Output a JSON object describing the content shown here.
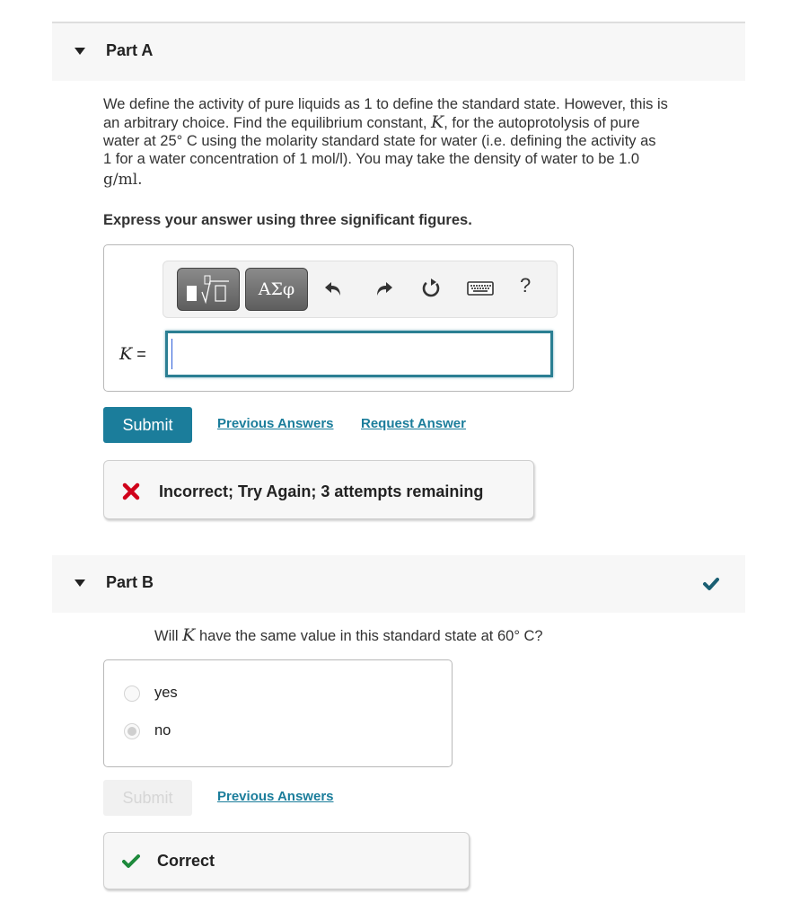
{
  "partA": {
    "title": "Part A",
    "question": {
      "line1": "We define the activity of pure liquids as 1 to define the standard state. However, this is",
      "line2_pre": "an arbitrary choice. Find the equilibrium constant, ",
      "line2_var": "K",
      "line2_post": ", for the autoprotolysis of pure",
      "line3": "water at 25° C using the molarity standard state for water (i.e. defining the activity as",
      "line4": "1 for a water concentration of 1 mol/l). You may take the density of water to be 1.0",
      "line5": "g/ml."
    },
    "instruction": "Express your answer using three significant figures.",
    "toolbar": {
      "templates_icon": "templates-sqrt-icon",
      "symbols_label": "ΑΣφ",
      "undo_icon": "undo-icon",
      "redo_icon": "redo-icon",
      "reset_icon": "reset-icon",
      "keyboard_icon": "keyboard-icon",
      "help_label": "?"
    },
    "input": {
      "label_var": "K",
      "label_eq": "=",
      "value": ""
    },
    "submit_label": "Submit",
    "previous_answers_label": "Previous Answers",
    "request_answer_label": "Request Answer",
    "feedback": {
      "icon": "x-icon",
      "text": "Incorrect; Try Again; 3 attempts remaining",
      "color": "#d0021b"
    }
  },
  "partB": {
    "title": "Part B",
    "status_icon": "check-icon",
    "question_pre": "Will ",
    "question_var": "K",
    "question_post": " have the same value in this standard state at 60° C?",
    "choices": [
      {
        "label": "yes",
        "selected": false
      },
      {
        "label": "no",
        "selected": true
      }
    ],
    "submit_label": "Submit",
    "previous_answers_label": "Previous Answers",
    "feedback": {
      "icon": "check-icon",
      "text": "Correct",
      "color": "#1e8a3c"
    }
  },
  "colors": {
    "accent": "#1b7d9b",
    "header_check": "#1a5f73"
  }
}
